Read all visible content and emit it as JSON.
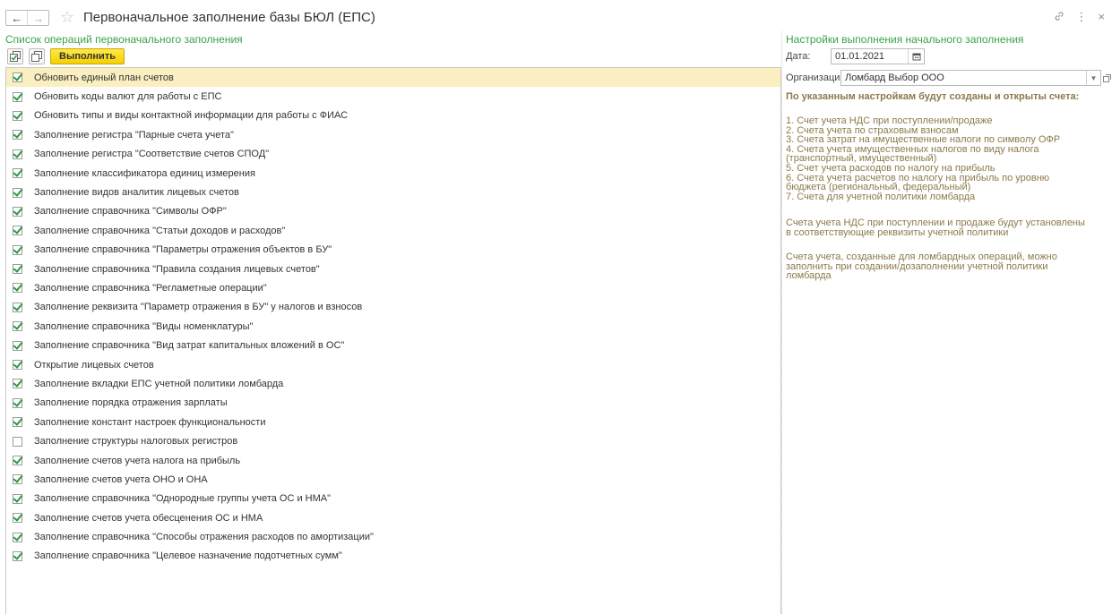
{
  "window": {
    "title": "Первоначальное заполнение базы БЮЛ (ЕПС)"
  },
  "left": {
    "header": "Список операций первоначального заполнения",
    "run_label": "Выполнить",
    "operations": [
      {
        "label": "Обновить единый план счетов",
        "checked": true,
        "selected": true
      },
      {
        "label": "Обновить коды валют для работы с ЕПС",
        "checked": true
      },
      {
        "label": "Обновить типы и виды контактной информации для работы с ФИАС",
        "checked": true
      },
      {
        "label": "Заполнение регистра \"Парные счета учета\"",
        "checked": true
      },
      {
        "label": "Заполнение регистра \"Соответствие счетов СПОД\"",
        "checked": true
      },
      {
        "label": "Заполнение классификатора единиц измерения",
        "checked": true
      },
      {
        "label": "Заполнение видов аналитик лицевых счетов",
        "checked": true
      },
      {
        "label": "Заполнение справочника \"Символы ОФР\"",
        "checked": true
      },
      {
        "label": "Заполнение справочника \"Статьи доходов и расходов\"",
        "checked": true
      },
      {
        "label": "Заполнение справочника \"Параметры отражения объектов в БУ\"",
        "checked": true
      },
      {
        "label": "Заполнение справочника \"Правила создания лицевых счетов\"",
        "checked": true
      },
      {
        "label": "Заполнение справочника \"Регламетные операции\"",
        "checked": true
      },
      {
        "label": "Заполнение реквизита \"Параметр отражения в БУ\" у налогов и взносов",
        "checked": true
      },
      {
        "label": "Заполнение справочника \"Виды номенклатуры\"",
        "checked": true
      },
      {
        "label": "Заполнение справочника \"Вид затрат капитальных вложений в ОС\"",
        "checked": true
      },
      {
        "label": "Открытие лицевых счетов",
        "checked": true
      },
      {
        "label": "Заполнение вкладки ЕПС учетной политики ломбарда",
        "checked": true
      },
      {
        "label": "Заполнение порядка отражения зарплаты",
        "checked": true
      },
      {
        "label": "Заполнение констант настроек функциональности",
        "checked": true
      },
      {
        "label": "Заполнение структуры налоговых регистров",
        "checked": false
      },
      {
        "label": "Заполнение счетов учета налога на прибыль",
        "checked": true
      },
      {
        "label": "Заполнение счетов учета ОНО и ОНА",
        "checked": true
      },
      {
        "label": "Заполнение справочника \"Однородные группы учета ОС и НМА\"",
        "checked": true
      },
      {
        "label": "Заполнение счетов учета обесценения ОС и НМА",
        "checked": true
      },
      {
        "label": "Заполнение справочника \"Способы отражения расходов по амортизации\"",
        "checked": true
      },
      {
        "label": "Заполнение справочника \"Целевое назначение подотчетных сумм\"",
        "checked": true
      }
    ]
  },
  "right": {
    "header": "Настройки выполнения начального заполнения",
    "date_label": "Дата:",
    "date_value": "01.01.2021",
    "org_label": "Организация:",
    "org_value": "Ломбард Выбор ООО",
    "info_title": "По указанным настройкам будут созданы и открыты счета:",
    "info_list": [
      "1. Счет учета НДС при поступлении/продаже",
      "2. Счета учета по страховым взносам",
      "3. Счета затрат на имущественные налоги по символу ОФР",
      "4. Счета учета имущественных налогов по виду налога",
      "(транспортный, имущественный)",
      "5. Счет учета расходов по налогу на прибыль",
      "6. Счета учета расчетов по налогу на прибыль по уровню",
      "бюджета (региональный, федеральный)",
      "7. Счета для учетной политики ломбарда"
    ],
    "note1": [
      "Счета учета НДС при поступлении и продаже будут установлены",
      "в соответствующие реквизиты учетной политики"
    ],
    "note2": [
      "Счета учета, созданные для ломбардных операций, можно",
      "заполнить при создании/дозаполнении учетной политики",
      "ломбарда"
    ]
  }
}
